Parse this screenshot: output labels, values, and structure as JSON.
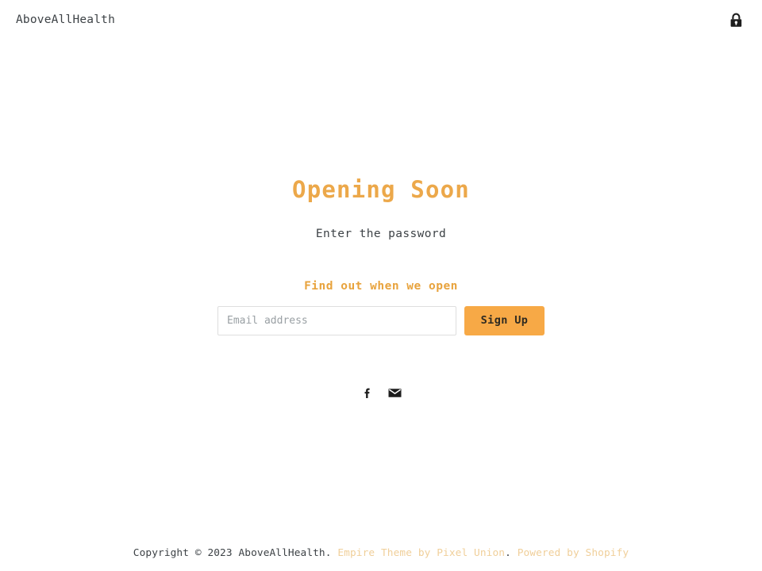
{
  "header": {
    "logo_text": "AboveAllHealth",
    "lock_icon": "closed-padlock-icon",
    "lock_aria": "Password page lock"
  },
  "main": {
    "headline": "Opening Soon",
    "password_prompt": "Enter the password",
    "signup_title": "Find out when we open",
    "email_placeholder": "Email address",
    "email_value": "",
    "signup_button_label": "Sign Up",
    "social": [
      {
        "name": "facebook-icon",
        "label": "Facebook"
      },
      {
        "name": "email-icon",
        "label": "Email"
      }
    ]
  },
  "footer": {
    "copyright": "Copyright © 2023 AboveAllHealth.",
    "theme_link": "Empire Theme by Pixel Union",
    "separator": ".",
    "powered_link": "Powered by Shopify"
  },
  "colors": {
    "accent_heading": "#eca84a",
    "accent_subheading": "#e8a33d",
    "button_bg": "#f7a946",
    "button_text": "#2e2a21",
    "body_text": "#3d4246",
    "input_border": "#dedede",
    "placeholder": "#9aa0a4",
    "footer_link": "#f0cf9a",
    "page_bg": "#ffffff"
  }
}
